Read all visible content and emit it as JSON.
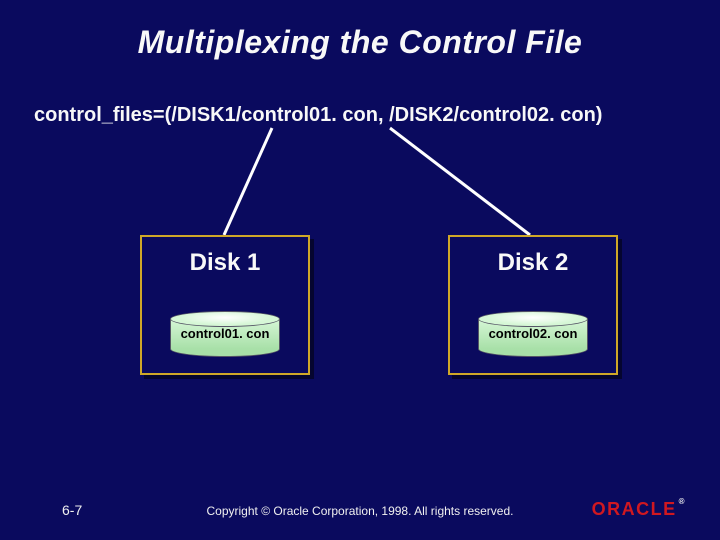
{
  "title": "Multiplexing the Control File",
  "param_line": "control_files=(/DISK1/control01. con, /DISK2/control02. con)",
  "disks": [
    {
      "label": "Disk 1",
      "file": "control01. con"
    },
    {
      "label": "Disk 2",
      "file": "control02. con"
    }
  ],
  "footer": {
    "page": "6-7",
    "copyright": "Copyright © Oracle Corporation, 1998. All rights reserved.",
    "logo_text": "ORACLE",
    "reg": "®"
  }
}
